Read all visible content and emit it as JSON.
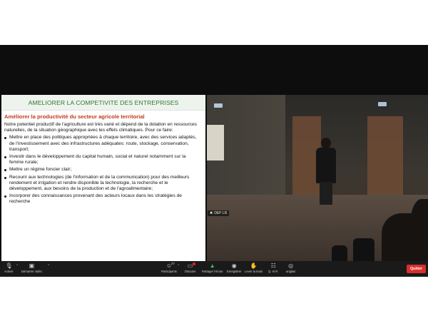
{
  "slide": {
    "title": "AMELIORER LA COMPETIVITE DES ENTREPRISES",
    "subtitle": "Améliorer la productivité du secteur agricole territorial",
    "intro": "Notre potentiel productif de l'agriculture est très varié et dépend de la dotation en ressources naturelles, de la situation géographique avec les effets climatiques. Pour ce faire:",
    "bullets": [
      "Mettre en place des politiques appropriées à chaque territoire, avec des services adaptés, de l'investissement avec des infrastructures adéquates: route, stockage, conservation, transport;",
      "Investir dans le développement du capital humain, social et naturel notamment sur la femme rurale;",
      "Mettre un régime foncier clair;",
      "Recourir aux technologies (de l'information et de la communication) pour des meilleurs rendement et irrigation et rendre disponible la technologie, la recherche et le développement, aux besoins de la production et de l'agroalimentaire;",
      "Incorporer des connaissances provenant des acteurs locaux dans les stratégies de recherche"
    ]
  },
  "video": {
    "participant_name": "DEP LR"
  },
  "toolbar": {
    "mute_label": "Activer",
    "video_label": "Démarrer vidéo",
    "participants_label": "Participants",
    "participants_count": "27",
    "chat_label": "Discuter",
    "share_label": "Partager l'écran",
    "record_label": "Enregistrer",
    "raise_hand_label": "Lever la main",
    "qa_label": "Q. et R.",
    "language_label": "anglais",
    "leave_label": "Quitter"
  }
}
